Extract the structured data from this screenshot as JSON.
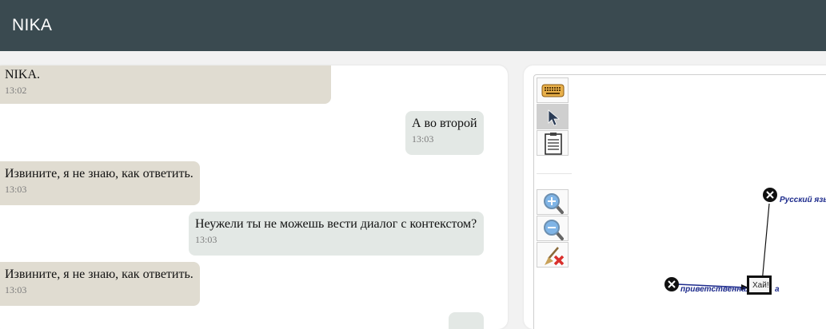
{
  "app": {
    "title": "NIKA"
  },
  "chat": {
    "top_fragment": "NIKA.",
    "messages": [
      {
        "sender": "bot",
        "text": "NIKA.",
        "time": "13:02"
      },
      {
        "sender": "user",
        "text": "А во второй",
        "time": "13:03"
      },
      {
        "sender": "bot",
        "text": "Извините, я не знаю, как ответить.",
        "time": "13:03"
      },
      {
        "sender": "user",
        "text": "Неужели ты не можешь вести диалог с контекстом?",
        "time": "13:03"
      },
      {
        "sender": "bot",
        "text": "Извините, я не знаю, как ответить.",
        "time": "13:03"
      }
    ]
  },
  "graph": {
    "toolbar": [
      {
        "name": "keyboard-icon",
        "state": "normal"
      },
      {
        "name": "pointer-icon",
        "state": "active"
      },
      {
        "name": "notepad-icon",
        "state": "normal"
      },
      {
        "name": "zoom-in-icon",
        "state": "normal"
      },
      {
        "name": "zoom-out-icon",
        "state": "normal"
      },
      {
        "name": "clear-broom-icon",
        "state": "normal"
      }
    ],
    "nodes": {
      "russian_language": "Русский язы",
      "greeting": "приветственная",
      "greeting_tail": "а",
      "box": "Хай!"
    }
  },
  "colors": {
    "header_bg": "#3a4a50",
    "bot_bubble": "#e0dcd1",
    "user_bubble": "#e3e8e5",
    "node_label": "#1c2a8c"
  }
}
